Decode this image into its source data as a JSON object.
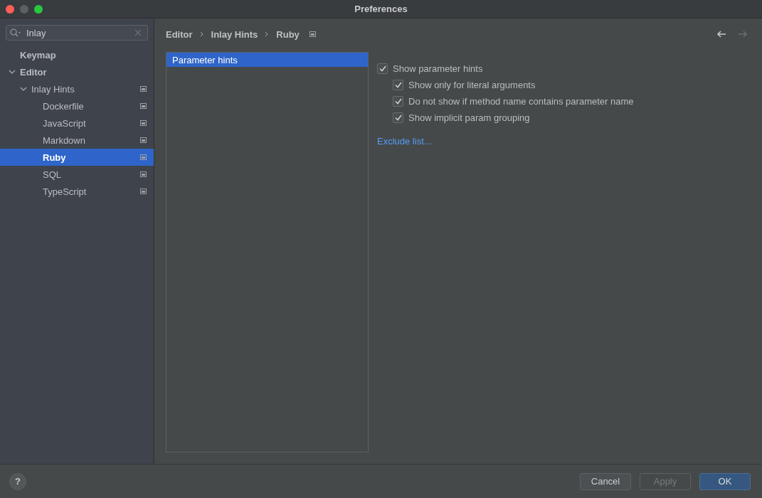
{
  "window": {
    "title": "Preferences"
  },
  "search": {
    "value": "Inlay"
  },
  "sidebar": {
    "items": [
      {
        "label": "Keymap",
        "selected": false,
        "has_settings_icon": false
      },
      {
        "label": "Editor",
        "selected": false,
        "expanded": true,
        "has_settings_icon": false,
        "children": [
          {
            "label": "Inlay Hints",
            "selected": false,
            "expanded": true,
            "has_settings_icon": true,
            "children": [
              {
                "label": "Dockerfile",
                "selected": false,
                "has_settings_icon": true
              },
              {
                "label": "JavaScript",
                "selected": false,
                "has_settings_icon": true
              },
              {
                "label": "Markdown",
                "selected": false,
                "has_settings_icon": true
              },
              {
                "label": "Ruby",
                "selected": true,
                "has_settings_icon": true
              },
              {
                "label": "SQL",
                "selected": false,
                "has_settings_icon": true
              },
              {
                "label": "TypeScript",
                "selected": false,
                "has_settings_icon": true
              }
            ]
          }
        ]
      }
    ]
  },
  "breadcrumb": [
    "Editor",
    "Inlay Hints",
    "Ruby"
  ],
  "hint_list": [
    {
      "label": "Parameter hints",
      "selected": true
    }
  ],
  "options": [
    {
      "label": "Show parameter hints",
      "checked": true,
      "children": [
        {
          "label": "Show only for literal arguments",
          "checked": true
        },
        {
          "label": "Do not show if method name contains parameter name",
          "checked": true
        },
        {
          "label": "Show implicit param grouping",
          "checked": true
        }
      ]
    }
  ],
  "exclude_link": "Exclude list...",
  "help": "?",
  "buttons": [
    {
      "label": "Cancel",
      "disabled": false,
      "primary": false
    },
    {
      "label": "Apply",
      "disabled": true,
      "primary": false
    },
    {
      "label": "OK",
      "disabled": false,
      "primary": true
    }
  ]
}
